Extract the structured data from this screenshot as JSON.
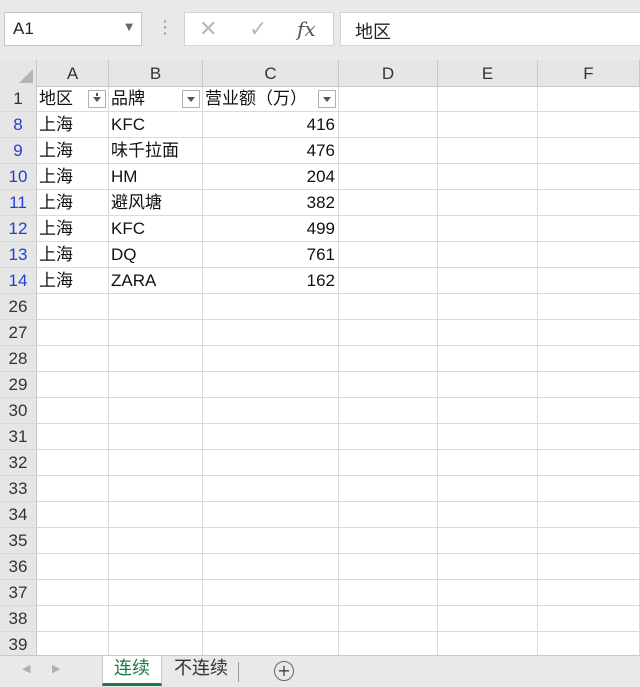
{
  "formula_bar": {
    "name_box": "A1",
    "cancel_icon": "✕",
    "enter_icon": "✓",
    "fx_label": "fx",
    "formula_value": "地区"
  },
  "columns": [
    "A",
    "B",
    "C",
    "D",
    "E",
    "F"
  ],
  "header_row": {
    "row": "1",
    "a": "地区",
    "b": "品牌",
    "c": "营业额（万）"
  },
  "rows": [
    {
      "row": "8",
      "a": "上海",
      "b": "KFC",
      "c": "416"
    },
    {
      "row": "9",
      "a": "上海",
      "b": "味千拉面",
      "c": "476"
    },
    {
      "row": "10",
      "a": "上海",
      "b": "HM",
      "c": "204"
    },
    {
      "row": "11",
      "a": "上海",
      "b": "避风塘",
      "c": "382"
    },
    {
      "row": "12",
      "a": "上海",
      "b": "KFC",
      "c": "499"
    },
    {
      "row": "13",
      "a": "上海",
      "b": "DQ",
      "c": "761"
    },
    {
      "row": "14",
      "a": "上海",
      "b": "ZARA",
      "c": "162"
    }
  ],
  "empty_rows": [
    "26",
    "27",
    "28",
    "29",
    "30",
    "31",
    "32",
    "33",
    "34",
    "35",
    "36",
    "37",
    "38",
    "39"
  ],
  "sheets": {
    "active": "连续",
    "other": "不连续",
    "add_icon": "+"
  },
  "colors": {
    "filtered_row_number": "#1f3fd8",
    "active_tab": "#1a7a45"
  }
}
